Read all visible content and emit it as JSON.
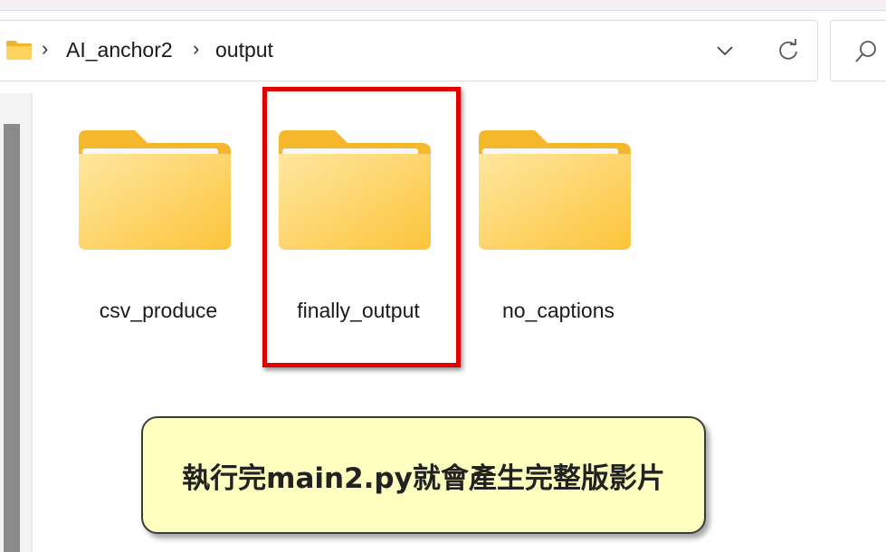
{
  "address_bar": {
    "breadcrumbs": [
      "AI_anchor2",
      "output"
    ],
    "separator": "›",
    "root_icon": "folder-icon",
    "history_icon": "chevron-down-icon",
    "refresh_icon": "refresh-icon"
  },
  "search": {
    "icon": "search-icon"
  },
  "folders": [
    {
      "name": "csv_produce",
      "icon": "folder-icon"
    },
    {
      "name": "finally_output",
      "icon": "folder-icon",
      "highlighted": true
    },
    {
      "name": "no_captions",
      "icon": "folder-icon"
    }
  ],
  "annotation": {
    "text": "執行完main2.py就會產生完整版影片",
    "highlight_color": "#e00000",
    "callout_color": "#ffffc0"
  }
}
